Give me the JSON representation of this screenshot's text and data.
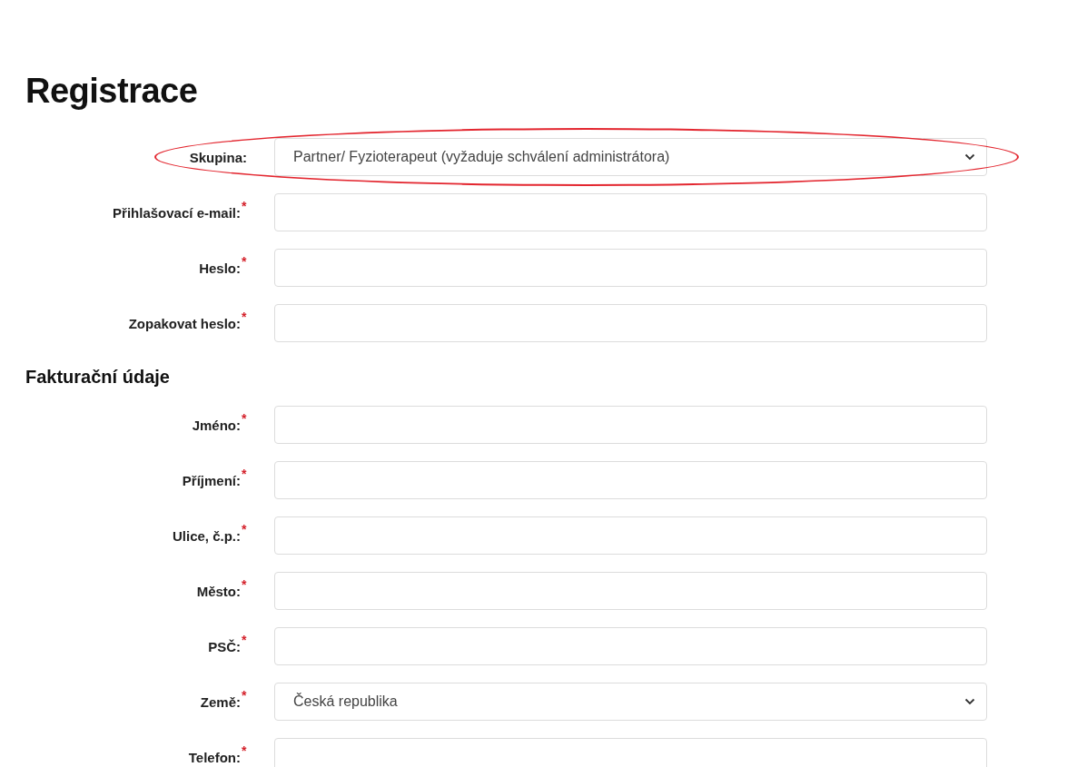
{
  "title": "Registrace",
  "sections": [
    {
      "fields": [
        {
          "kind": "select",
          "label": "Skupina:",
          "value": "Partner/ Fyzioterapeut (vyžaduje schválení administrátora)",
          "highlighted": true
        },
        {
          "kind": "text",
          "label": "Přihlašovací e-mail:",
          "required_mark": "*",
          "highlighted": false
        },
        {
          "kind": "text",
          "label": "Heslo:",
          "required_mark": "*",
          "highlighted": false
        },
        {
          "kind": "text",
          "label": "Zopakovat heslo:",
          "required_mark": "*",
          "highlighted": false
        }
      ]
    },
    {
      "title": "Fakturační údaje",
      "fields": [
        {
          "kind": "text",
          "label": "Jméno:",
          "required_mark": "*",
          "highlighted": false
        },
        {
          "kind": "text",
          "label": "Příjmení:",
          "required_mark": "*",
          "highlighted": false
        },
        {
          "kind": "text",
          "label": "Ulice, č.p.:",
          "required_mark": "*",
          "highlighted": false
        },
        {
          "kind": "text",
          "label": "Město:",
          "required_mark": "*",
          "highlighted": false
        },
        {
          "kind": "text",
          "label": "PSČ:",
          "required_mark": "*",
          "highlighted": false
        },
        {
          "kind": "select",
          "label": "Země:",
          "required_mark": "*",
          "value": "Česká republika",
          "highlighted": false
        },
        {
          "kind": "text",
          "label": "Telefon:",
          "required_mark": "*",
          "highlighted": false
        }
      ]
    }
  ]
}
